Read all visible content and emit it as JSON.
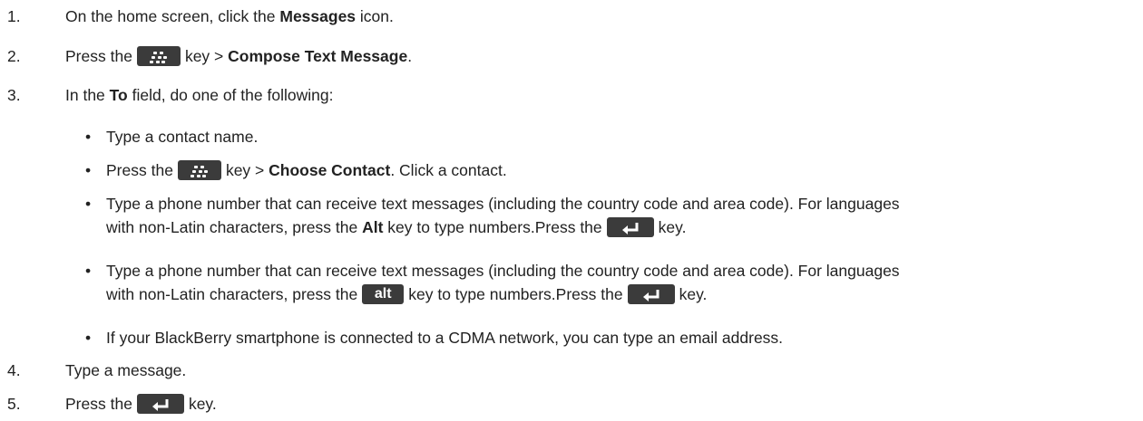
{
  "steps": [
    {
      "num": "1.",
      "pre": "On the home screen, click the ",
      "bold": "Messages",
      "post": " icon."
    },
    {
      "num": "2.",
      "pre": "Press the",
      "mid": "key > ",
      "bold": "Compose Text Message",
      "post": "."
    },
    {
      "num": "3.",
      "pre": "In the ",
      "bold": "To",
      "post": " field, do one of the following:"
    },
    {
      "num": "4.",
      "text": "Type a message."
    },
    {
      "num": "5.",
      "pre": "Press the",
      "post": "key."
    }
  ],
  "bullets": {
    "glyph": "•",
    "b1": "Type a contact name.",
    "b2": {
      "pre": "Press the",
      "mid": "key > ",
      "bold": "Choose Contact",
      "post": ". Click a contact."
    },
    "b3": {
      "line1": "Type a phone number that can receive text messages (including the country code and area code). For languages",
      "pre": "with non-Latin characters, press the ",
      "bold": "Alt",
      "mid": " key to type numbers.Press the",
      "post": "key."
    },
    "b4": {
      "line1": "Type a phone number that can receive text messages (including the country code and area code). For languages",
      "pre": "with non-Latin characters, press the",
      "mid": "key to type numbers.Press the",
      "post": "key."
    },
    "b5": "If your BlackBerry smartphone is connected to a CDMA network, you can type an email address."
  },
  "keys": {
    "menu_icon": "blackberry-menu-icon",
    "enter_icon": "enter-arrow-icon",
    "alt_label": "alt"
  }
}
